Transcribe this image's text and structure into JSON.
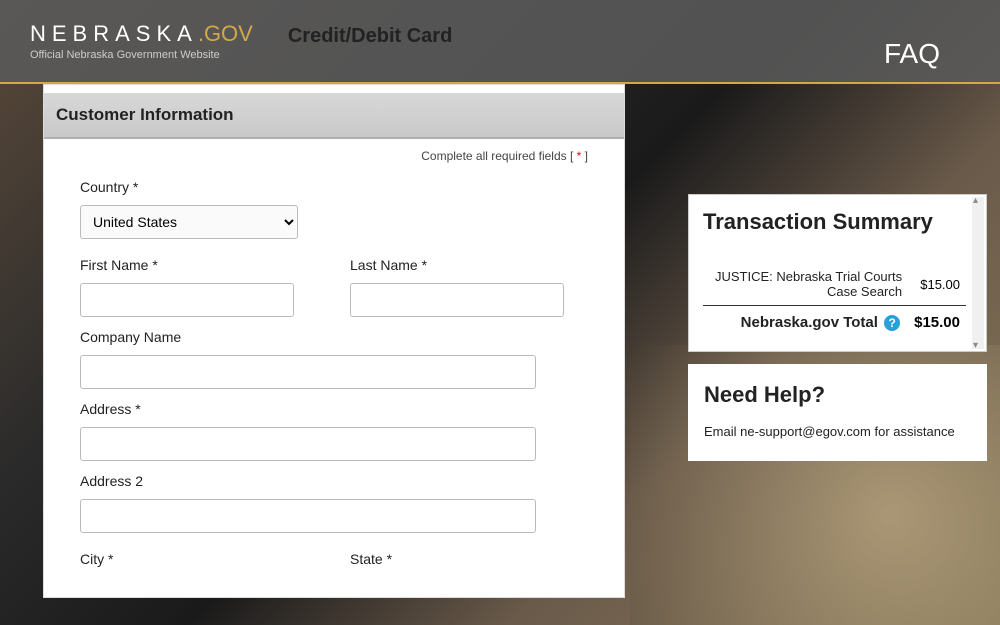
{
  "header": {
    "logo_text": "NEBRASKA",
    "logo_suffix": ".GOV",
    "logo_sub": "Official Nebraska Government Website",
    "page_title": "Credit/Debit Card",
    "faq": "FAQ"
  },
  "form": {
    "section_title": "Customer Information",
    "required_prefix": "Complete all required fields [ ",
    "required_star": "*",
    "required_suffix": " ]",
    "country_label": "Country *",
    "country_value": "United States",
    "first_name_label": "First Name *",
    "last_name_label": "Last Name *",
    "company_label": "Company Name",
    "address_label": "Address *",
    "address2_label": "Address 2",
    "city_label": "City *",
    "state_label": "State *"
  },
  "summary": {
    "title": "Transaction Summary",
    "item_desc": "JUSTICE: Nebraska Trial Courts Case Search",
    "item_amount": "$15.00",
    "total_label": "Nebraska.gov Total",
    "total_amount": "$15.00",
    "help_icon": "?"
  },
  "help": {
    "title": "Need Help?",
    "text": "Email ne-support@egov.com for assistance"
  }
}
